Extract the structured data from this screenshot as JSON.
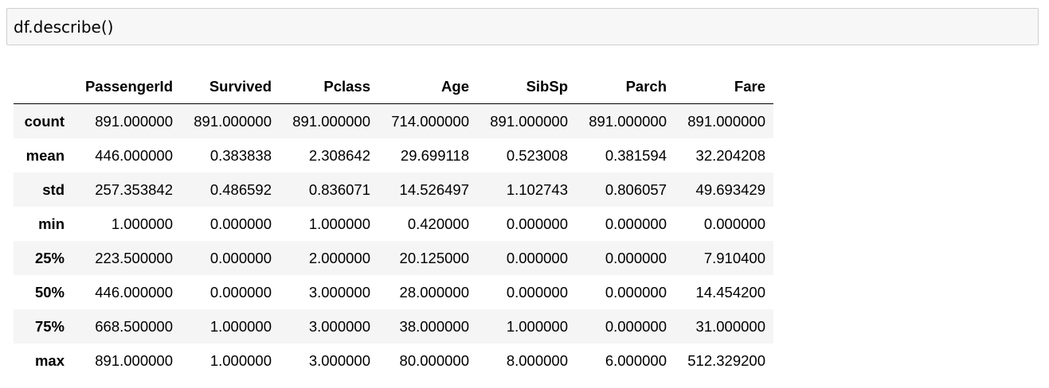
{
  "cell": {
    "code": "df.describe()"
  },
  "table": {
    "index_header": "",
    "columns": [
      "PassengerId",
      "Survived",
      "Pclass",
      "Age",
      "SibSp",
      "Parch",
      "Fare"
    ],
    "rows": [
      {
        "label": "count",
        "values": [
          "891.000000",
          "891.000000",
          "891.000000",
          "714.000000",
          "891.000000",
          "891.000000",
          "891.000000"
        ]
      },
      {
        "label": "mean",
        "values": [
          "446.000000",
          "0.383838",
          "2.308642",
          "29.699118",
          "0.523008",
          "0.381594",
          "32.204208"
        ]
      },
      {
        "label": "std",
        "values": [
          "257.353842",
          "0.486592",
          "0.836071",
          "14.526497",
          "1.102743",
          "0.806057",
          "49.693429"
        ]
      },
      {
        "label": "min",
        "values": [
          "1.000000",
          "0.000000",
          "1.000000",
          "0.420000",
          "0.000000",
          "0.000000",
          "0.000000"
        ]
      },
      {
        "label": "25%",
        "values": [
          "223.500000",
          "0.000000",
          "2.000000",
          "20.125000",
          "0.000000",
          "0.000000",
          "7.910400"
        ]
      },
      {
        "label": "50%",
        "values": [
          "446.000000",
          "0.000000",
          "3.000000",
          "28.000000",
          "0.000000",
          "0.000000",
          "14.454200"
        ]
      },
      {
        "label": "75%",
        "values": [
          "668.500000",
          "1.000000",
          "3.000000",
          "38.000000",
          "1.000000",
          "0.000000",
          "31.000000"
        ]
      },
      {
        "label": "max",
        "values": [
          "891.000000",
          "1.000000",
          "3.000000",
          "80.000000",
          "8.000000",
          "6.000000",
          "512.329200"
        ]
      }
    ]
  }
}
